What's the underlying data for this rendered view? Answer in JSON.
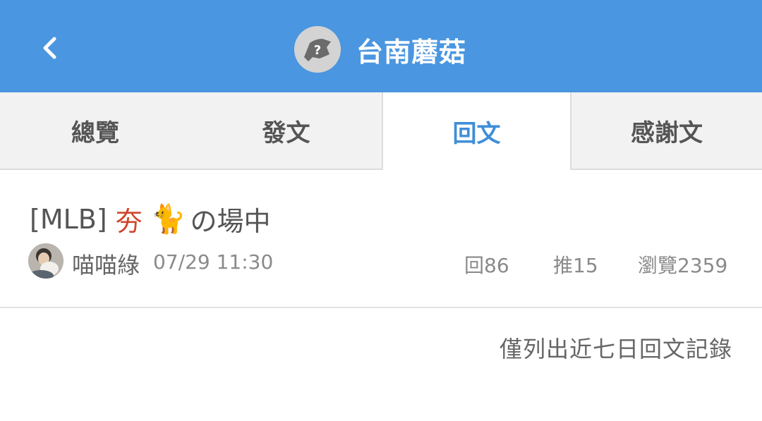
{
  "header": {
    "back_icon": "chevron-left-icon",
    "title": "台南蘑菇",
    "background": "#4a96e0"
  },
  "tabs": [
    {
      "label": "總覽",
      "active": false
    },
    {
      "label": "發文",
      "active": false
    },
    {
      "label": "回文",
      "active": true
    },
    {
      "label": "感謝文",
      "active": false
    }
  ],
  "post": {
    "title_prefix": "[MLB]",
    "title_highlight": "夯",
    "title_emoji": "🐈",
    "title_suffix": "の場中",
    "author": "喵喵綠",
    "time": "07/29 11:30",
    "stats": {
      "replies": "回86",
      "pushes": "推15",
      "views": "瀏覽2359"
    }
  },
  "footer_note": "僅列出近七日回文記錄",
  "colors": {
    "accent": "#3f8ed8",
    "highlight_red": "#d0452b"
  }
}
